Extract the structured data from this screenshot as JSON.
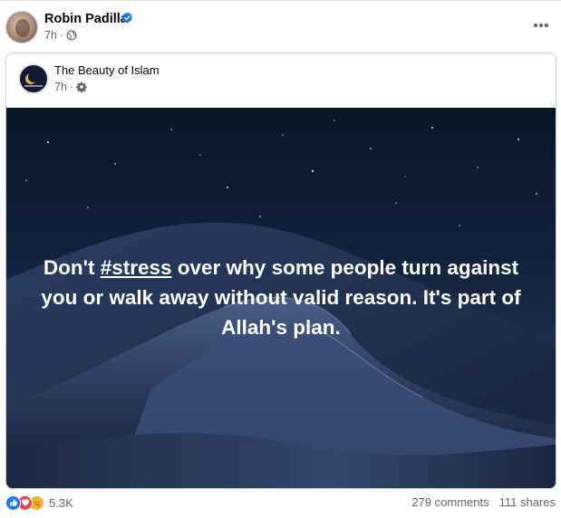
{
  "post": {
    "author": "Robin Padilla",
    "time": "7h",
    "time_separator": "·"
  },
  "shared": {
    "page_name": "The Beauty of Islam",
    "time": "7h",
    "time_separator": "·",
    "quote_pre": "Don't ",
    "quote_tag": "#stress",
    "quote_post": " over why some people turn against you or walk away without valid reason. It's part of Allah's plan."
  },
  "footer": {
    "reaction_count": "5.3K",
    "comments": "279 comments",
    "shares": "111 shares"
  },
  "colors": {
    "verified": "#1877f2",
    "like": "#1877f2",
    "love": "#f33e58",
    "care": "#f7b125",
    "secondary_text": "#65676b"
  },
  "icons": [
    "verified-badge-icon",
    "globe-icon",
    "gear-icon",
    "more-icon",
    "like-icon",
    "love-icon",
    "care-icon"
  ]
}
